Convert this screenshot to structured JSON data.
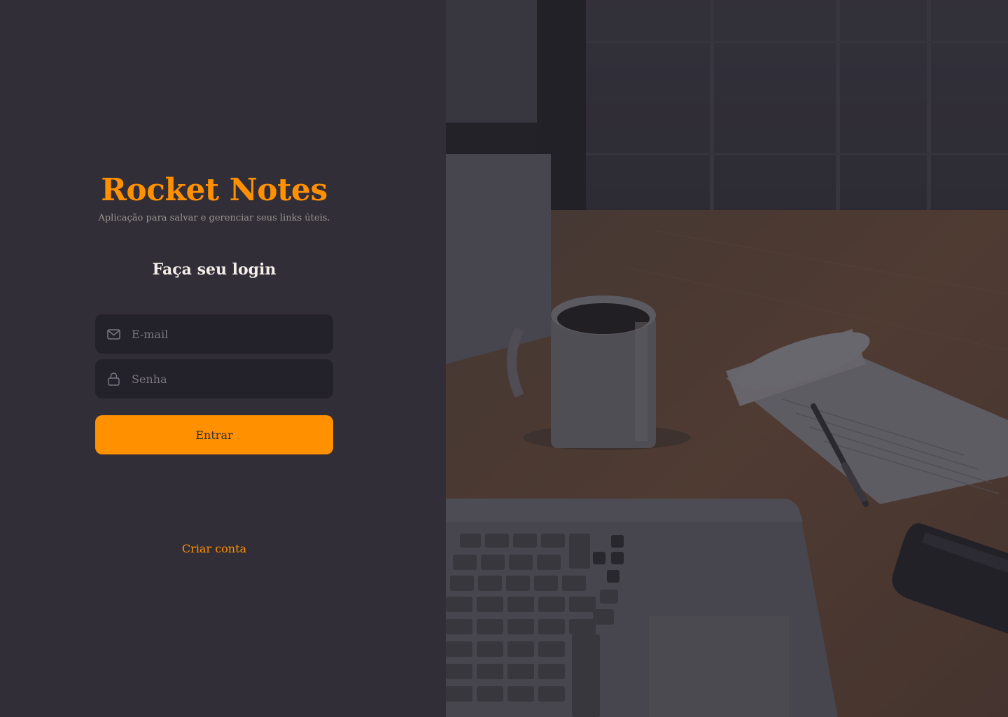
{
  "app": {
    "title": "Rocket Notes",
    "tagline": "Aplicação para salvar e gerenciar seus links úteis."
  },
  "form": {
    "title": "Faça seu login",
    "email": {
      "placeholder": "E-mail",
      "icon": "mail-icon"
    },
    "password": {
      "placeholder": "Senha",
      "icon": "lock-icon"
    },
    "submit_label": "Entrar"
  },
  "links": {
    "create_account": "Criar conta"
  },
  "colors": {
    "background": "#312e38",
    "input_background": "#232129",
    "accent": "#ff9000",
    "text": "#f4ede8",
    "muted": "#999591",
    "placeholder": "#7b7681"
  }
}
